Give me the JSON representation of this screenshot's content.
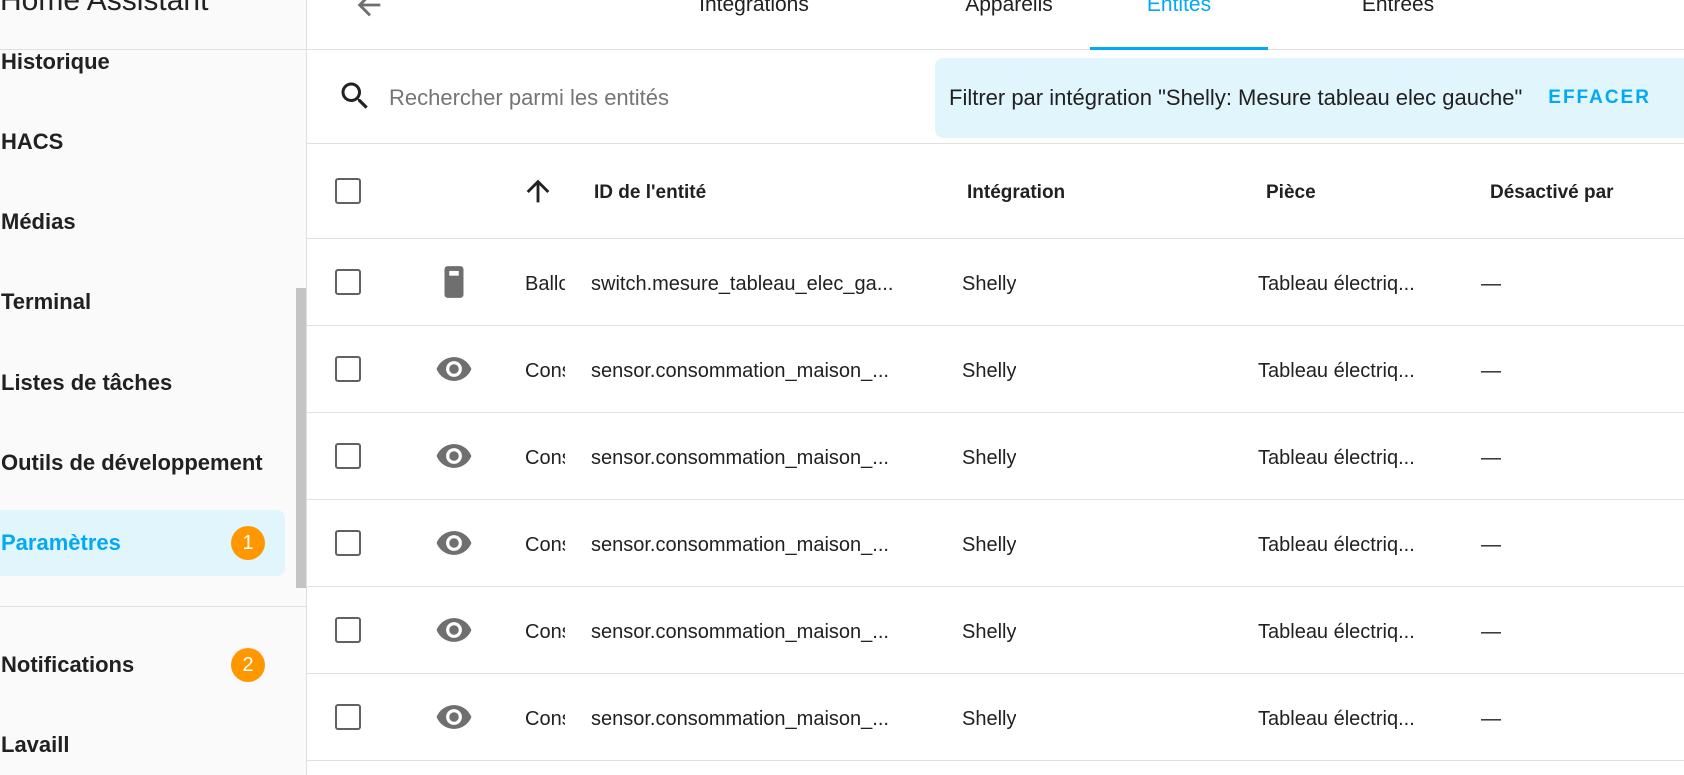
{
  "app": {
    "title": "Home Assistant"
  },
  "sidebar": {
    "items": [
      {
        "label": "Historique"
      },
      {
        "label": "HACS"
      },
      {
        "label": "Médias"
      },
      {
        "label": "Terminal"
      },
      {
        "label": "Listes de tâches"
      },
      {
        "label": "Outils de développement"
      },
      {
        "label": "Paramètres",
        "badge": "1",
        "active": true
      }
    ],
    "notifications": {
      "label": "Notifications",
      "badge": "2"
    },
    "user": {
      "label": "Lavaill"
    }
  },
  "tabs": [
    {
      "label": "Intégrations"
    },
    {
      "label": "Appareils"
    },
    {
      "label": "Entités",
      "active": true
    },
    {
      "label": "Entrées"
    }
  ],
  "search": {
    "placeholder": "Rechercher parmi les entités",
    "value": ""
  },
  "filter": {
    "text": "Filtrer par intégration \"Shelly: Mesure tableau elec gauche\"",
    "clear_label": "EFFACER"
  },
  "table": {
    "columns": {
      "entity_id": "ID de l'entité",
      "integration": "Intégration",
      "room": "Pièce",
      "disabled_by": "Désactivé par"
    },
    "rows": [
      {
        "icon": "switch-icon",
        "name": "Ballo",
        "entity_id": "switch.mesure_tableau_elec_ga...",
        "integration": "Shelly",
        "room": "Tableau électriq...",
        "disabled_by": "—"
      },
      {
        "icon": "eye-icon",
        "name": "Cons",
        "entity_id": "sensor.consommation_maison_...",
        "integration": "Shelly",
        "room": "Tableau électriq...",
        "disabled_by": "—"
      },
      {
        "icon": "eye-icon",
        "name": "Cons",
        "entity_id": "sensor.consommation_maison_...",
        "integration": "Shelly",
        "room": "Tableau électriq...",
        "disabled_by": "—"
      },
      {
        "icon": "eye-icon",
        "name": "Cons",
        "entity_id": "sensor.consommation_maison_...",
        "integration": "Shelly",
        "room": "Tableau électriq...",
        "disabled_by": "—"
      },
      {
        "icon": "eye-icon",
        "name": "Cons",
        "entity_id": "sensor.consommation_maison_...",
        "integration": "Shelly",
        "room": "Tableau électriq...",
        "disabled_by": "—"
      },
      {
        "icon": "eye-icon",
        "name": "Cons",
        "entity_id": "sensor.consommation_maison_...",
        "integration": "Shelly",
        "room": "Tableau électriq...",
        "disabled_by": "—"
      }
    ]
  },
  "colors": {
    "accent": "#03a9f4",
    "accent_bg": "#e1f5fc",
    "badge": "#ff9800",
    "icon": "#6f6f6f"
  }
}
